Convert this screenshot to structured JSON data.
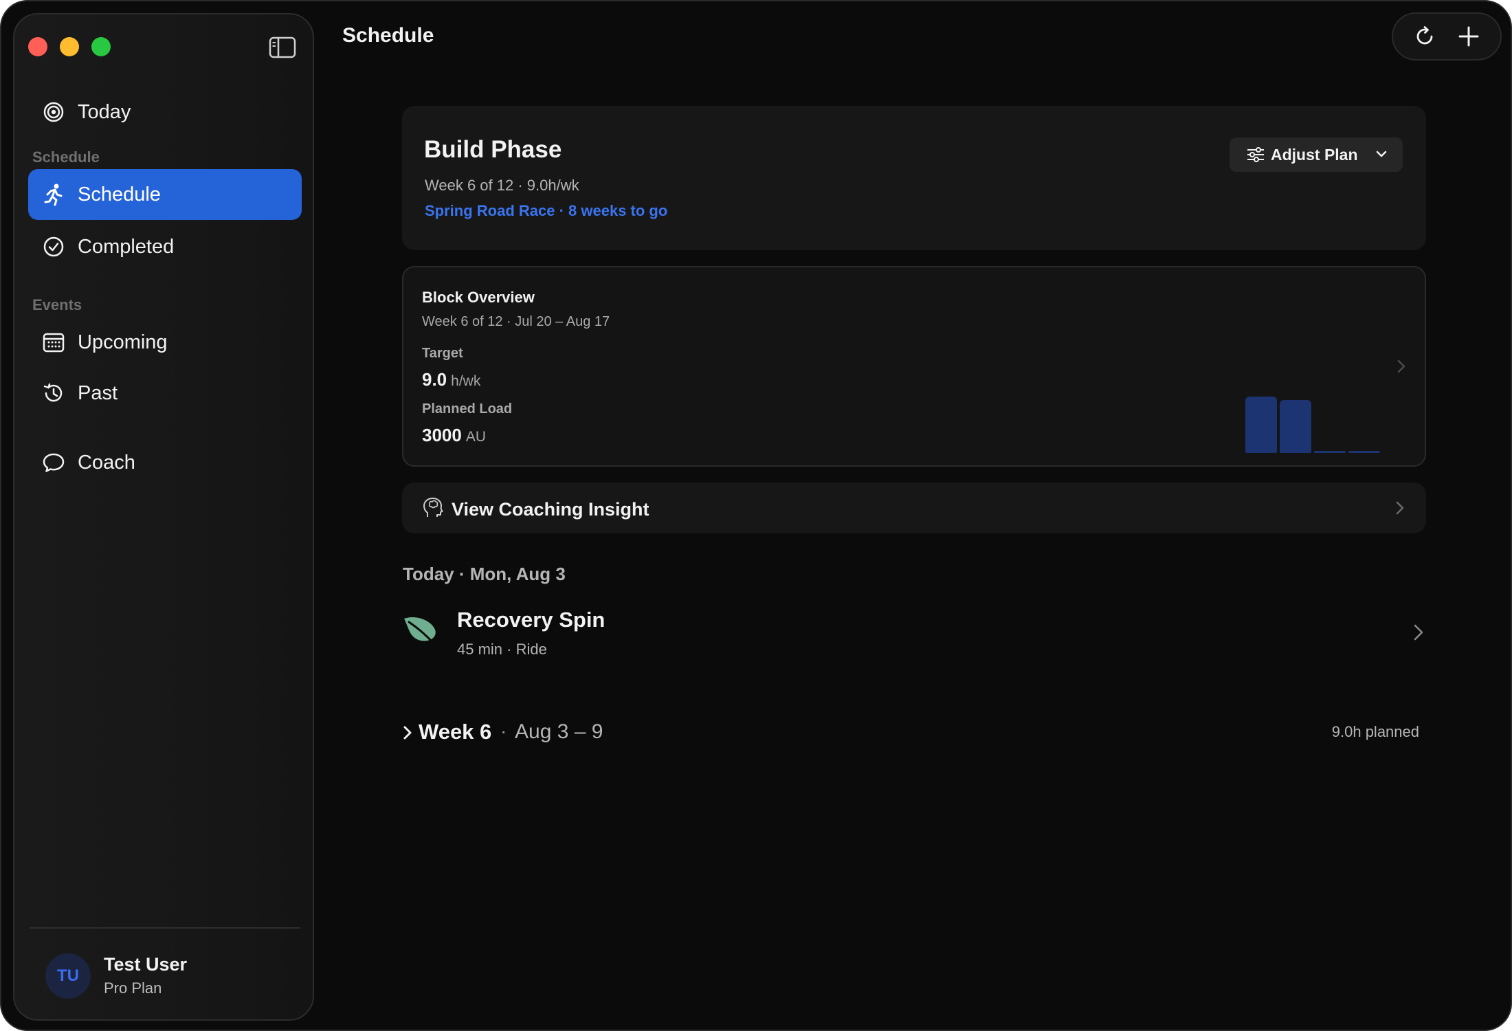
{
  "header": {
    "title": "Schedule"
  },
  "sidebar": {
    "today_label": "Today",
    "section_schedule": "Schedule",
    "items_schedule": [
      {
        "label": "Schedule",
        "icon": "runner-icon",
        "active": true
      },
      {
        "label": "Completed",
        "icon": "check-circle-icon",
        "active": false
      }
    ],
    "section_events": "Events",
    "items_events": [
      {
        "label": "Upcoming",
        "icon": "calendar-icon"
      },
      {
        "label": "Past",
        "icon": "history-icon"
      }
    ],
    "coach_label": "Coach",
    "user": {
      "initials": "TU",
      "name": "Test User",
      "plan": "Pro Plan"
    }
  },
  "phase": {
    "title": "Build Phase",
    "subtitle": "Week 6 of 12 · 9.0h/wk",
    "race": "Spring Road Race · 8 weeks to go",
    "adjust_label": "Adjust Plan"
  },
  "block_overview": {
    "title": "Block Overview",
    "subtitle": "Week 6 of 12 · Jul 20 – Aug 17",
    "target_label": "Target",
    "target_value": "9.0",
    "target_unit": "h/wk",
    "load_label": "Planned Load",
    "load_value": "3000",
    "load_unit": "AU",
    "mini_chart_levels": [
      0.95,
      0.9,
      0.04,
      0.04
    ]
  },
  "insight": {
    "label": "View Coaching Insight"
  },
  "today": {
    "label": "Today · Mon, Aug 3",
    "workout": {
      "title": "Recovery Spin",
      "subtitle": "45 min · Ride",
      "icon": "leaf-icon"
    }
  },
  "week": {
    "title": "Week 6",
    "separator": "·",
    "range": "Aug 3 – 9",
    "planned": "9.0h planned"
  },
  "colors": {
    "accent": "#2563d9",
    "link": "#3a74f0",
    "leaf": "#6fae8e",
    "chart_bar": "#1d3473"
  }
}
